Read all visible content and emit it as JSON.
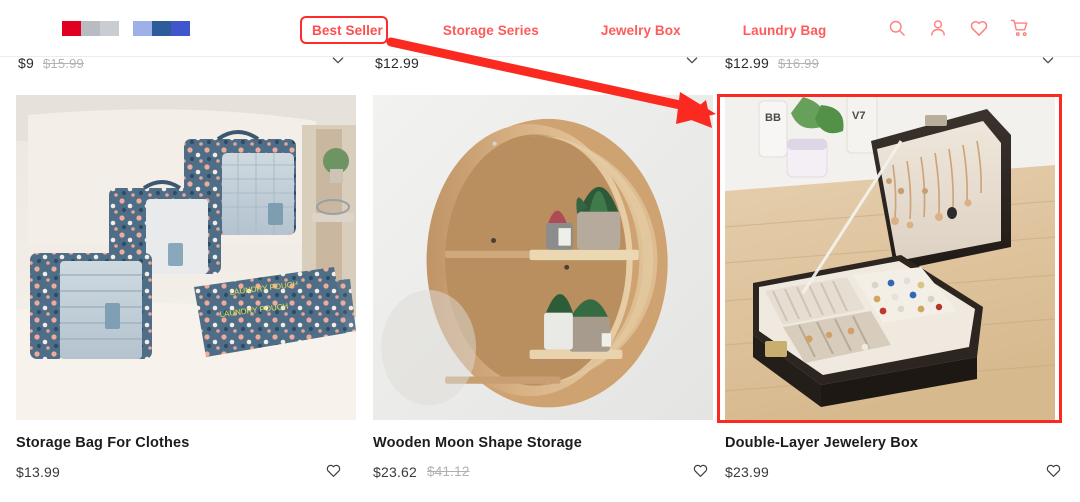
{
  "header": {
    "swatch_groups": [
      {
        "name": "swatch-group-1",
        "colors": [
          "#e00020",
          "#b8bcc2",
          "#c9cdd2"
        ]
      },
      {
        "name": "swatch-group-2",
        "colors": [
          "#9db0e8",
          "#2e5b9a",
          "#4156cd"
        ]
      }
    ],
    "nav": [
      {
        "label": "Best Seller",
        "active": true
      },
      {
        "label": "Storage Series",
        "active": false
      },
      {
        "label": "Jewelry Box",
        "active": false
      },
      {
        "label": "Laundry Bag",
        "active": false
      }
    ],
    "icons": [
      {
        "name": "search-icon",
        "label": "Search"
      },
      {
        "name": "account-icon",
        "label": "Account"
      },
      {
        "name": "wishlist-heart-icon",
        "label": "Wishlist"
      },
      {
        "name": "shopping-cart-icon",
        "label": "Cart"
      }
    ],
    "icon_color": "#ff8080",
    "nav_color": "#ff5a5a"
  },
  "clipped_row": {
    "cells": [
      {
        "price": "$9",
        "price_old": "$15.99"
      },
      {
        "price": "$12.99",
        "price_old": ""
      },
      {
        "price": "$12.99",
        "price_old": "$16.99"
      }
    ],
    "chevron_icon": "chevron-down-icon"
  },
  "products": [
    {
      "title": "Storage Bag For Clothes",
      "price": "$13.99",
      "price_old": "",
      "image_alt": "Set of blue floral-print packing cubes and laundry pouches arranged on a cream sofa",
      "wishlist_icon": "heart-outline-icon",
      "highlighted": false
    },
    {
      "title": "Wooden Moon Shape Storage",
      "price": "$23.62",
      "price_old": "$41.12",
      "image_alt": "Crescent moon shaped wooden wall shelf holding small potted succulents",
      "wishlist_icon": "heart-outline-icon",
      "highlighted": false
    },
    {
      "title": "Double-Layer Jewelery Box",
      "price": "$23.99",
      "price_old": "",
      "image_alt": "Open black double-layer jewelry box with necklaces, rings and earrings on a wooden table",
      "wishlist_icon": "heart-outline-icon",
      "highlighted": true
    }
  ],
  "annotations": {
    "color": "#fa2a20",
    "nav_highlight_target": "Best Seller",
    "card_highlight_target": "Double-Layer Jewelery Box",
    "arrow": "arrow pointing from Best Seller tab to the Double-Layer Jewelery Box card"
  }
}
